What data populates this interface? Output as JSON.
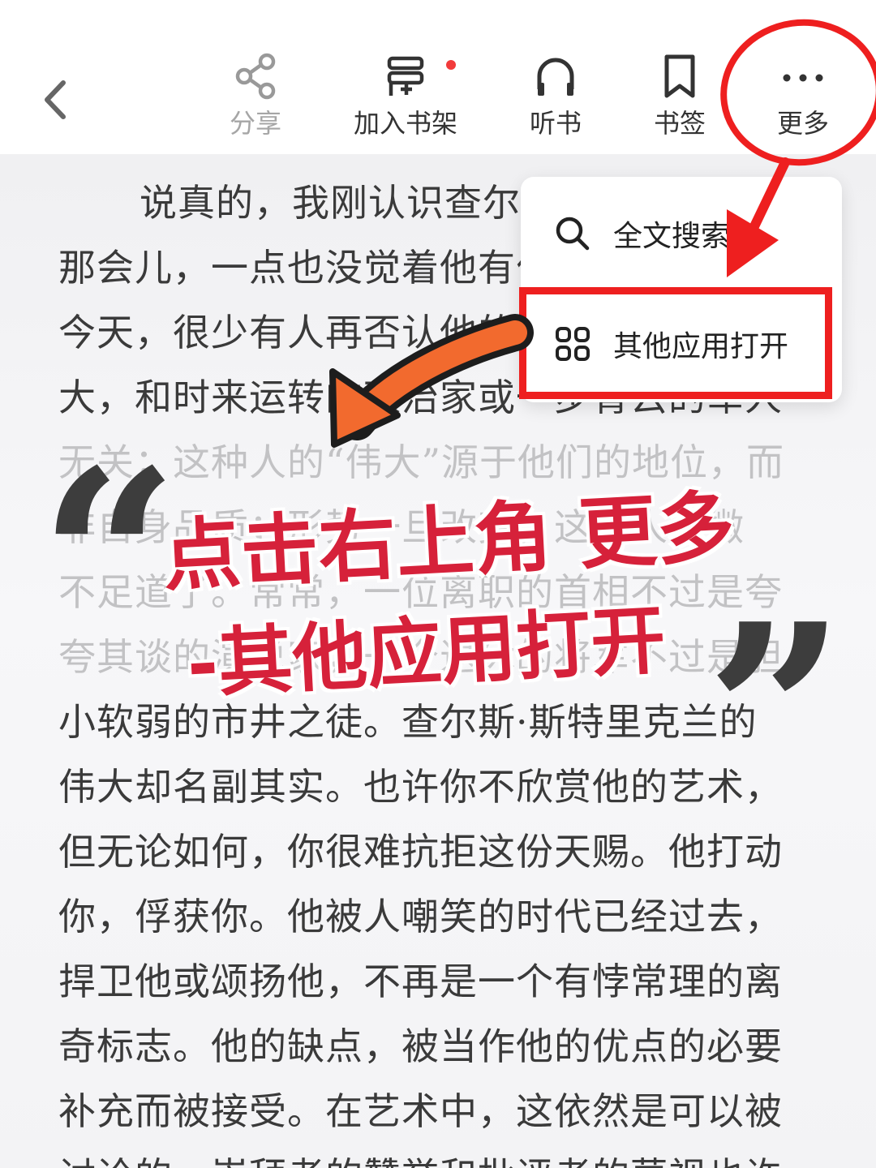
{
  "toolbar": {
    "back": "chevron-left-icon",
    "items": [
      {
        "label": "分享",
        "icon": "share-icon"
      },
      {
        "label": "加入书架",
        "icon": "add-to-shelf-icon"
      },
      {
        "label": "听书",
        "icon": "headphones-icon"
      },
      {
        "label": "书签",
        "icon": "bookmark-icon"
      },
      {
        "label": "更多",
        "icon": "more-dots-icon"
      }
    ]
  },
  "menu": {
    "items": [
      {
        "label": "全文搜索",
        "icon": "search-icon"
      },
      {
        "label": "其他应用打开",
        "icon": "apps-grid-icon"
      }
    ]
  },
  "reader": {
    "lines": [
      "说真的，我刚认识查尔斯·斯特里克兰的",
      "那会儿，一点也没觉着他有什么不同寻常。",
      "今天，很少有人再否认他的伟大。我说的伟",
      "大，和时来运转的政治家或一步青云的军人",
      "无关；这种人的“伟大”源于他们的地位，而",
      "非自身品质；形势一旦改变，这种人就微",
      "不足道了。常常，一位离职的首相不过是夸",
      "夸其谈的演说家，一个退休的将军不过是胆",
      "小软弱的市井之徒。查尔斯·斯特里克兰的",
      "伟大却名副其实。也许你不欣赏他的艺术，",
      "但无论如何，你很难抗拒这份天赐。他打动",
      "你，俘获你。他被人嘲笑的时代已经过去，",
      "捍卫他或颂扬他，不再是一个有悖常理的离",
      "奇标志。他的缺点，被当作他的优点的必要",
      "补充而被接受。在艺术中，这依然是可以被",
      "讨论的，崇拜者的赞誉和批评者的蔑视也许"
    ]
  },
  "annotation": {
    "line1": "点击右上角 更多",
    "line2": "-其他应用打开",
    "quote_open": "“",
    "quote_close": "”",
    "colors": {
      "highlight": "#ee1f1f",
      "arrow": "#f26a2e",
      "caption": "#d6213a"
    }
  }
}
